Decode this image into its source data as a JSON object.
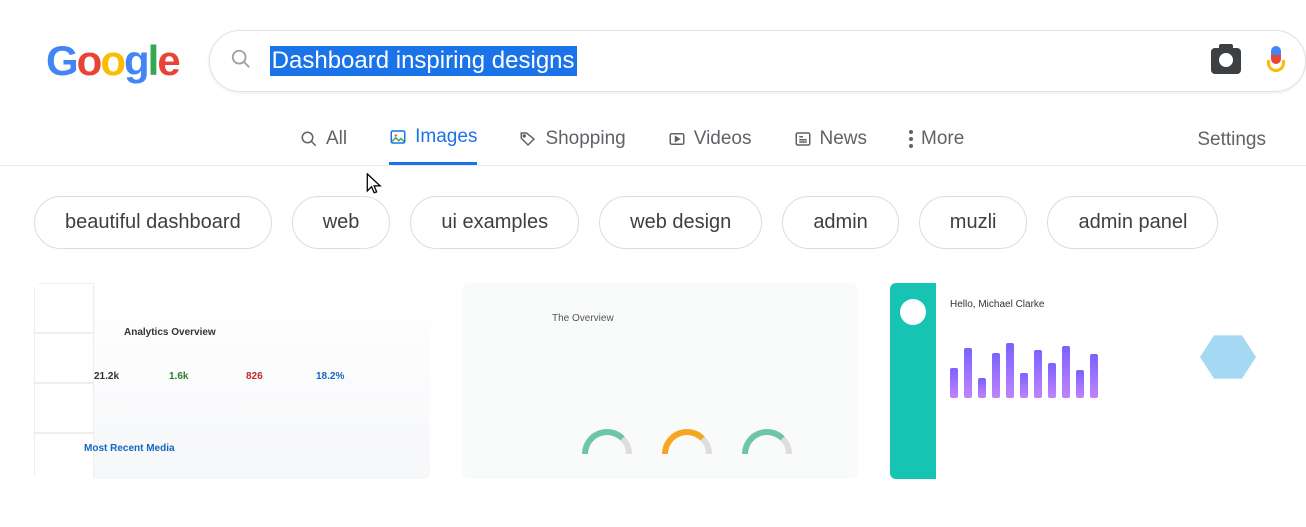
{
  "logo_text": "Google",
  "search": {
    "value": "Dashboard inspiring designs",
    "selected": true
  },
  "tabs": {
    "all": "All",
    "images": "Images",
    "shopping": "Shopping",
    "videos": "Videos",
    "news": "News",
    "more": "More",
    "active": "images"
  },
  "settings": "Settings",
  "chips": [
    "beautiful dashboard",
    "web",
    "ui examples",
    "web design",
    "admin",
    "muzli",
    "admin panel"
  ],
  "thumb1": {
    "heading": "Analytics Overview",
    "stats": [
      "21.2k",
      "1.6k",
      "826",
      "18.2%"
    ],
    "footer": "Most Recent Media"
  },
  "thumb2": {
    "heading": "The Overview"
  },
  "thumb3": {
    "greeting": "Hello, Michael Clarke"
  }
}
